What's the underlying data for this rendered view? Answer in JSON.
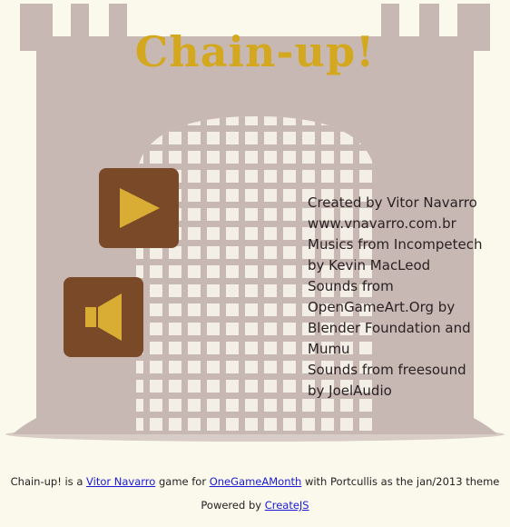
{
  "game": {
    "title": "Chain-up!",
    "colors": {
      "background": "#fbf9ec",
      "castle": "#c8b8b4",
      "gate": "#f3efe6",
      "title": "#d4a81e",
      "button_bg": "#7a4a28",
      "button_icon": "#d9ad33"
    },
    "play_button": {
      "icon": "play-icon"
    },
    "sound_button": {
      "icon": "speaker-icon"
    },
    "credits": [
      "Created by Vitor Navarro",
      "www.vnavarro.com.br",
      "Musics from Incompetech",
      "by Kevin MacLeod",
      "Sounds from",
      "OpenGameArt.Org by",
      "Blender Foundation and",
      "Mumu",
      "Sounds from freesound",
      "by JoelAudio"
    ]
  },
  "footer": {
    "line1": {
      "project": "Chain-up!",
      "is_a": " is a ",
      "author_link": "Vitor Navarro",
      "game_for": " game for ",
      "event_link": "OneGameAMonth",
      "theme_text": " with Portcullis as the jan/2013 theme"
    },
    "line2": {
      "powered_by": "Powered by ",
      "engine_link": "CreateJS"
    }
  }
}
